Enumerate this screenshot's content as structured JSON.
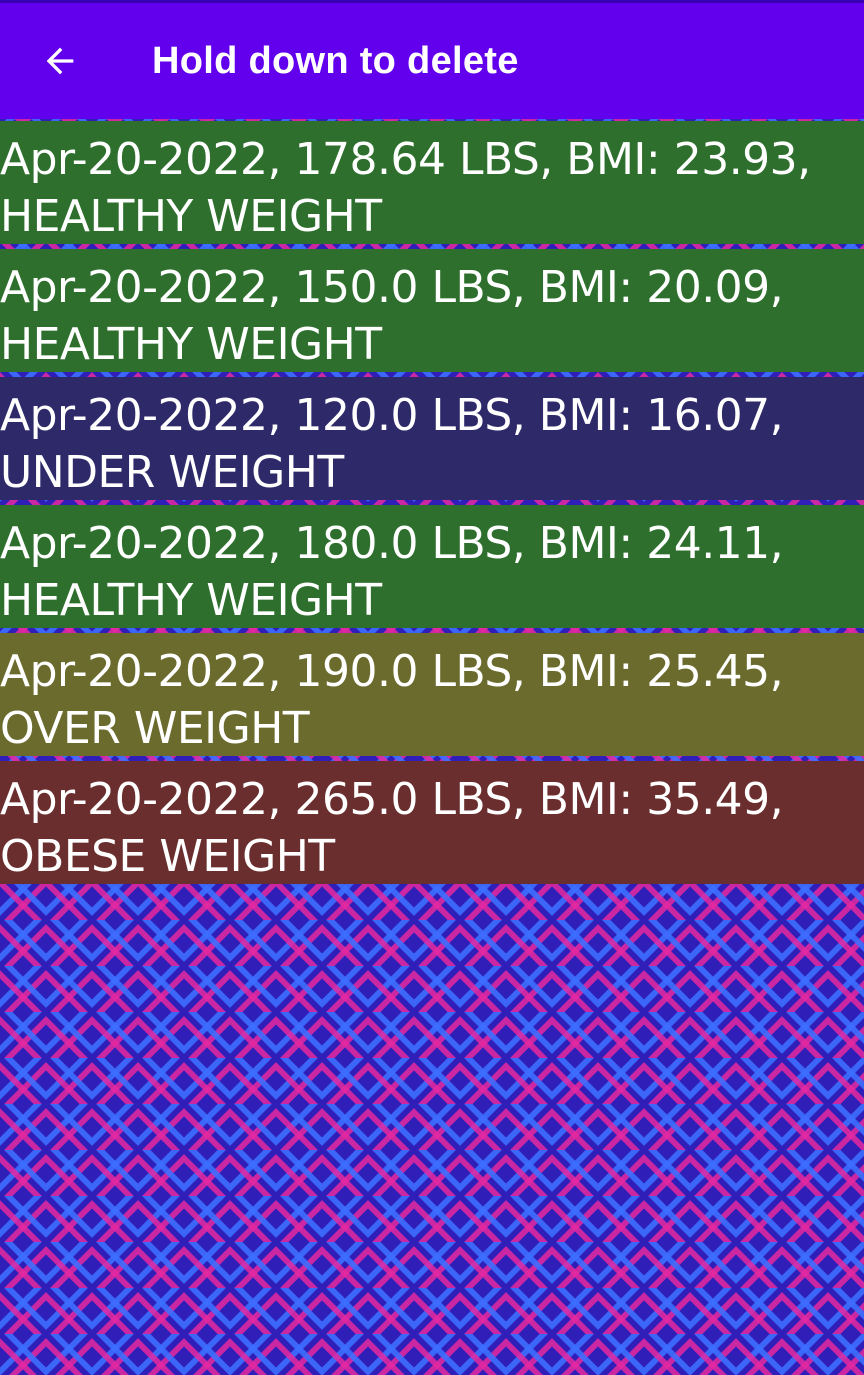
{
  "appbar": {
    "title": "Hold down to delete",
    "back_icon": "arrow-left-icon",
    "color": "#6200ee"
  },
  "entries": [
    {
      "line1": "Apr-20-2022, 178.64 LBS, BMI: 23.93,",
      "line2": "HEALTHY WEIGHT",
      "color": "#2e6f2e"
    },
    {
      "line1": "Apr-20-2022, 150.0 LBS, BMI: 20.09,",
      "line2": "HEALTHY WEIGHT",
      "color": "#2e6f2e"
    },
    {
      "line1": "Apr-20-2022, 120.0 LBS, BMI: 16.07,",
      "line2": "UNDER WEIGHT",
      "color": "#2e2a6a"
    },
    {
      "line1": "Apr-20-2022, 180.0 LBS, BMI: 24.11,",
      "line2": "HEALTHY WEIGHT",
      "color": "#2e6f2e"
    },
    {
      "line1": "Apr-20-2022, 190.0 LBS, BMI: 25.45,",
      "line2": "OVER WEIGHT",
      "color": "#6b6b2e"
    },
    {
      "line1": "Apr-20-2022, 265.0 LBS, BMI: 35.49,",
      "line2": "OBESE WEIGHT",
      "color": "#6b2e2e"
    }
  ]
}
